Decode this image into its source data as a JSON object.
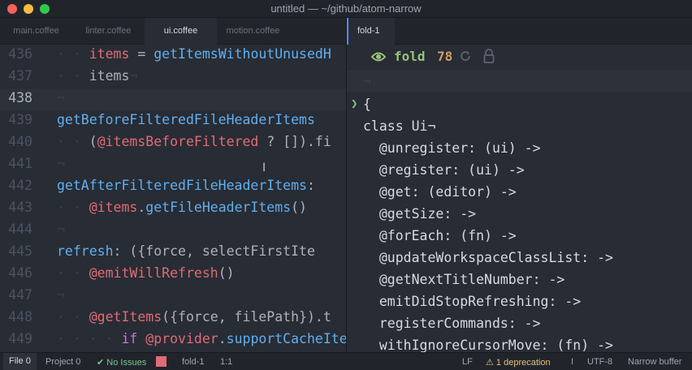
{
  "window": {
    "title": "untitled — ~/github/atom-narrow",
    "controls": [
      "close",
      "minimize",
      "maximize"
    ]
  },
  "left_tabs": [
    {
      "label": "main.coffee",
      "active": false
    },
    {
      "label": "linter.coffee",
      "active": false
    },
    {
      "label": "ui.coffee",
      "active": true
    },
    {
      "label": "motion.coffee",
      "active": false
    }
  ],
  "right_tabs": [
    {
      "label": "fold-1",
      "active": true
    }
  ],
  "editor": {
    "line_numbers": [
      "436",
      "437",
      "438",
      "439",
      "440",
      "441",
      "442",
      "443",
      "444",
      "445",
      "446",
      "447",
      "448",
      "449"
    ],
    "current_line": "438",
    "lines": [
      [
        {
          "t": "· · ",
          "c": "ws"
        },
        {
          "t": "items",
          "c": "var"
        },
        {
          "t": " = ",
          "c": "txt"
        },
        {
          "t": "getItemsWithoutUnusedH",
          "c": "fn"
        }
      ],
      [
        {
          "t": "· · ",
          "c": "ws"
        },
        {
          "t": "items",
          "c": "txt"
        },
        {
          "t": "¬",
          "c": "ws"
        }
      ],
      [
        {
          "t": "¬",
          "c": "ws"
        }
      ],
      [
        {
          "t": "getBeforeFilteredFileHeaderItems",
          "c": "fn"
        }
      ],
      [
        {
          "t": "· · ",
          "c": "ws"
        },
        {
          "t": "(",
          "c": "txt"
        },
        {
          "t": "@itemsBeforeFiltered",
          "c": "var"
        },
        {
          "t": " ? ",
          "c": "txt"
        },
        {
          "t": "[]",
          "c": "txt"
        },
        {
          "t": ").fi",
          "c": "txt"
        }
      ],
      [
        {
          "t": "¬",
          "c": "ws"
        }
      ],
      [
        {
          "t": "getAfterFilteredFileHeaderItems",
          "c": "fn"
        },
        {
          "t": ":",
          "c": "txt"
        }
      ],
      [
        {
          "t": "· · ",
          "c": "ws"
        },
        {
          "t": "@items",
          "c": "var"
        },
        {
          "t": ".",
          "c": "txt"
        },
        {
          "t": "getFileHeaderItems",
          "c": "fn"
        },
        {
          "t": "()",
          "c": "txt"
        }
      ],
      [
        {
          "t": "¬",
          "c": "ws"
        }
      ],
      [
        {
          "t": "refresh",
          "c": "fn"
        },
        {
          "t": ": ({force, selectFirstIte",
          "c": "txt"
        }
      ],
      [
        {
          "t": "· · ",
          "c": "ws"
        },
        {
          "t": "@emitWillRefresh",
          "c": "var"
        },
        {
          "t": "()",
          "c": "txt"
        }
      ],
      [
        {
          "t": "¬",
          "c": "ws"
        }
      ],
      [
        {
          "t": "· · ",
          "c": "ws"
        },
        {
          "t": "@getItems",
          "c": "var"
        },
        {
          "t": "({force, filePath}).t",
          "c": "txt"
        }
      ],
      [
        {
          "t": "· · · · ",
          "c": "ws"
        },
        {
          "t": "if ",
          "c": "kw"
        },
        {
          "t": "@provider",
          "c": "var"
        },
        {
          "t": ".",
          "c": "txt"
        },
        {
          "t": "supportCacheIte",
          "c": "fn"
        }
      ]
    ]
  },
  "narrow": {
    "filter_label": "fold",
    "count": "78",
    "query": "¬",
    "lines": [
      "{",
      "class Ui¬",
      "  @unregister: (ui) ->",
      "  @register: (ui) ->",
      "  @get: (editor) ->",
      "  @getSize: ->",
      "  @forEach: (fn) ->",
      "  @updateWorkspaceClassList: ->",
      "  @getNextTitleNumber: ->",
      "  emitDidStopRefreshing: ->",
      "  registerCommands: ->",
      "  withIgnoreCursorMove: (fn) ->"
    ]
  },
  "statusbar": {
    "file": "File 0",
    "project": "Project 0",
    "no_issues": "No Issues",
    "fold": "fold-1",
    "position": "1:1",
    "line_ending": "LF",
    "deprecation": "1 deprecation",
    "separator": "I",
    "encoding": "UTF-8",
    "grammar": "Narrow buffer"
  },
  "colors": {
    "accent": "#568af2",
    "green": "#98c379",
    "orange": "#d19a66",
    "red": "#e06c75",
    "blue": "#61afef",
    "warning": "#e5c07b"
  },
  "icons": [
    "eye-icon",
    "refresh-icon",
    "lock-icon",
    "check-icon",
    "warning-icon",
    "ibeam-cursor-icon"
  ]
}
